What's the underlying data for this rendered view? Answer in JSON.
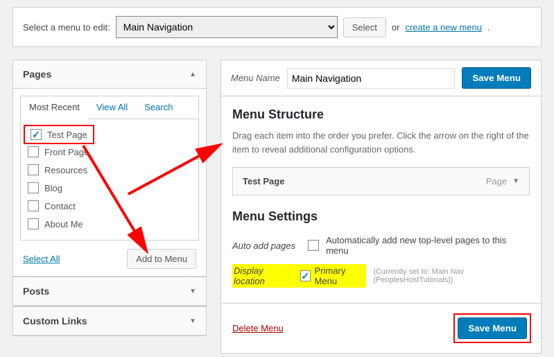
{
  "topbar": {
    "label": "Select a menu to edit:",
    "selected": "Main Navigation",
    "select_btn": "Select",
    "or": "or",
    "create_link": "create a new menu"
  },
  "accordions": {
    "pages": "Pages",
    "posts": "Posts",
    "custom_links": "Custom Links"
  },
  "tabs": {
    "most_recent": "Most Recent",
    "view_all": "View All",
    "search": "Search"
  },
  "pages": [
    {
      "label": "Test Page",
      "checked": true
    },
    {
      "label": "Front Page",
      "checked": false
    },
    {
      "label": "Resources",
      "checked": false
    },
    {
      "label": "Blog",
      "checked": false
    },
    {
      "label": "Contact",
      "checked": false
    },
    {
      "label": "About Me",
      "checked": false
    }
  ],
  "select_all": "Select All",
  "add_to_menu": "Add to Menu",
  "menu_name_label": "Menu Name",
  "menu_name_value": "Main Navigation",
  "save_menu": "Save Menu",
  "structure_title": "Menu Structure",
  "structure_desc": "Drag each item into the order you prefer. Click the arrow on the right of the item to reveal additional configuration options.",
  "menu_item": {
    "title": "Test Page",
    "type": "Page"
  },
  "settings_title": "Menu Settings",
  "auto_add": {
    "label": "Auto add pages",
    "desc": "Automatically add new top-level pages to this menu"
  },
  "display_loc": {
    "label": "Display location",
    "option": "Primary Menu",
    "note": "(Currently set to: Main Nav (PeoplesHostTutorials))"
  },
  "delete_menu": "Delete Menu"
}
